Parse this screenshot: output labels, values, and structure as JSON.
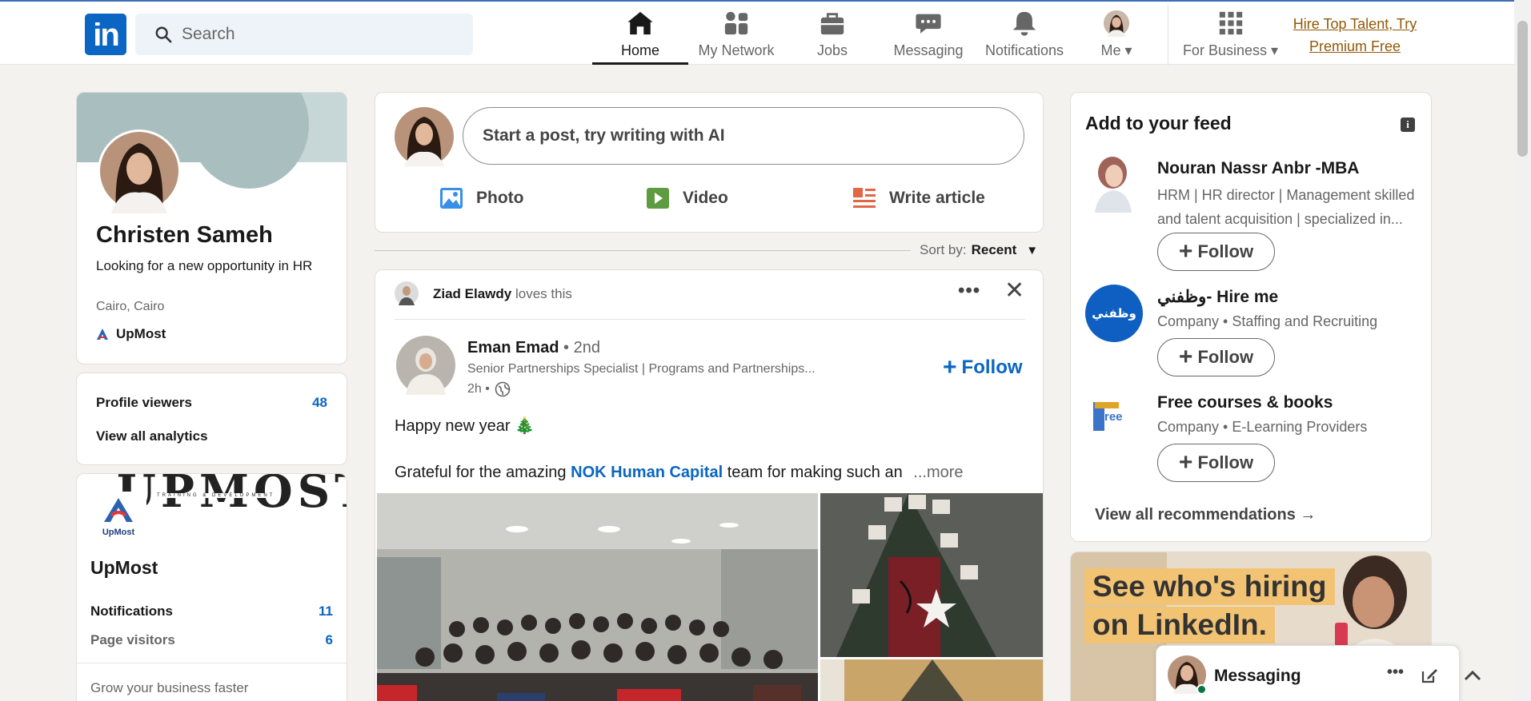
{
  "nav": {
    "logo": "in",
    "search_placeholder": "Search",
    "items": [
      {
        "label": "Home",
        "icon": "home-icon"
      },
      {
        "label": "My Network",
        "icon": "people-icon"
      },
      {
        "label": "Jobs",
        "icon": "briefcase-icon"
      },
      {
        "label": "Messaging",
        "icon": "chat-icon"
      },
      {
        "label": "Notifications",
        "icon": "bell-icon"
      },
      {
        "label": "Me",
        "icon": "avatar"
      },
      {
        "label": "For Business",
        "icon": "grid-icon"
      }
    ],
    "premium_line1": "Hire Top Talent, Try",
    "premium_line2": "Premium Free"
  },
  "profile": {
    "name": "Christen Sameh",
    "headline": "Looking for a new opportunity in HR",
    "location": "Cairo, Cairo",
    "company": "UpMost",
    "viewers_label": "Profile viewers",
    "viewers_count": "48",
    "analytics_link": "View all analytics"
  },
  "page_card": {
    "name": "UpMost",
    "logo_text": "UpMost",
    "banner_text": "UPMOST",
    "banner_sub": "TRAINING & DEVELOPMENT",
    "notifications_label": "Notifications",
    "notifications_count": "11",
    "visitors_label": "Page visitors",
    "visitors_count": "6",
    "grow_text": "Grow your business faster"
  },
  "composer": {
    "placeholder": "Start a post, try writing with AI",
    "actions": [
      {
        "label": "Photo",
        "icon": "photo-icon",
        "color": "#378fe9"
      },
      {
        "label": "Video",
        "icon": "video-icon",
        "color": "#5f9b41"
      },
      {
        "label": "Write article",
        "icon": "article-icon",
        "color": "#e06847"
      }
    ]
  },
  "sort": {
    "label": "Sort by:",
    "value": "Recent"
  },
  "post": {
    "social_actor": "Ziad Elawdy",
    "social_action": "loves this",
    "author": "Eman Emad",
    "degree": "• 2nd",
    "author_headline": "Senior Partnerships Specialist | Programs and Partnerships...",
    "time": "2h •",
    "follow_label": "Follow",
    "text_line1": "Happy new year 🎄",
    "text_line2_pre": "Grateful for the amazing",
    "text_link": "NOK Human Capital",
    "text_line2_post": "team for making such an",
    "more_label": "...more"
  },
  "feed_suggestions": {
    "title": "Add to your feed",
    "items": [
      {
        "name": "Nouran Nassr Anbr -MBA",
        "desc_line1": "HRM | HR director | Management skilled",
        "desc_line2": "and talent acquisition | specialized in...",
        "follow": "Follow"
      },
      {
        "name": "وظفني- Hire me",
        "desc_line1": "Company • Staffing and Recruiting",
        "follow": "Follow",
        "logo_text": "وظفني"
      },
      {
        "name": "Free courses & books",
        "desc_line1": "Company • E-Learning Providers",
        "follow": "Follow",
        "logo_text": "ree"
      }
    ],
    "view_all": "View all recommendations →"
  },
  "ad": {
    "line1": "See who's hiring",
    "line2": "on LinkedIn."
  },
  "messaging": {
    "label": "Messaging"
  }
}
